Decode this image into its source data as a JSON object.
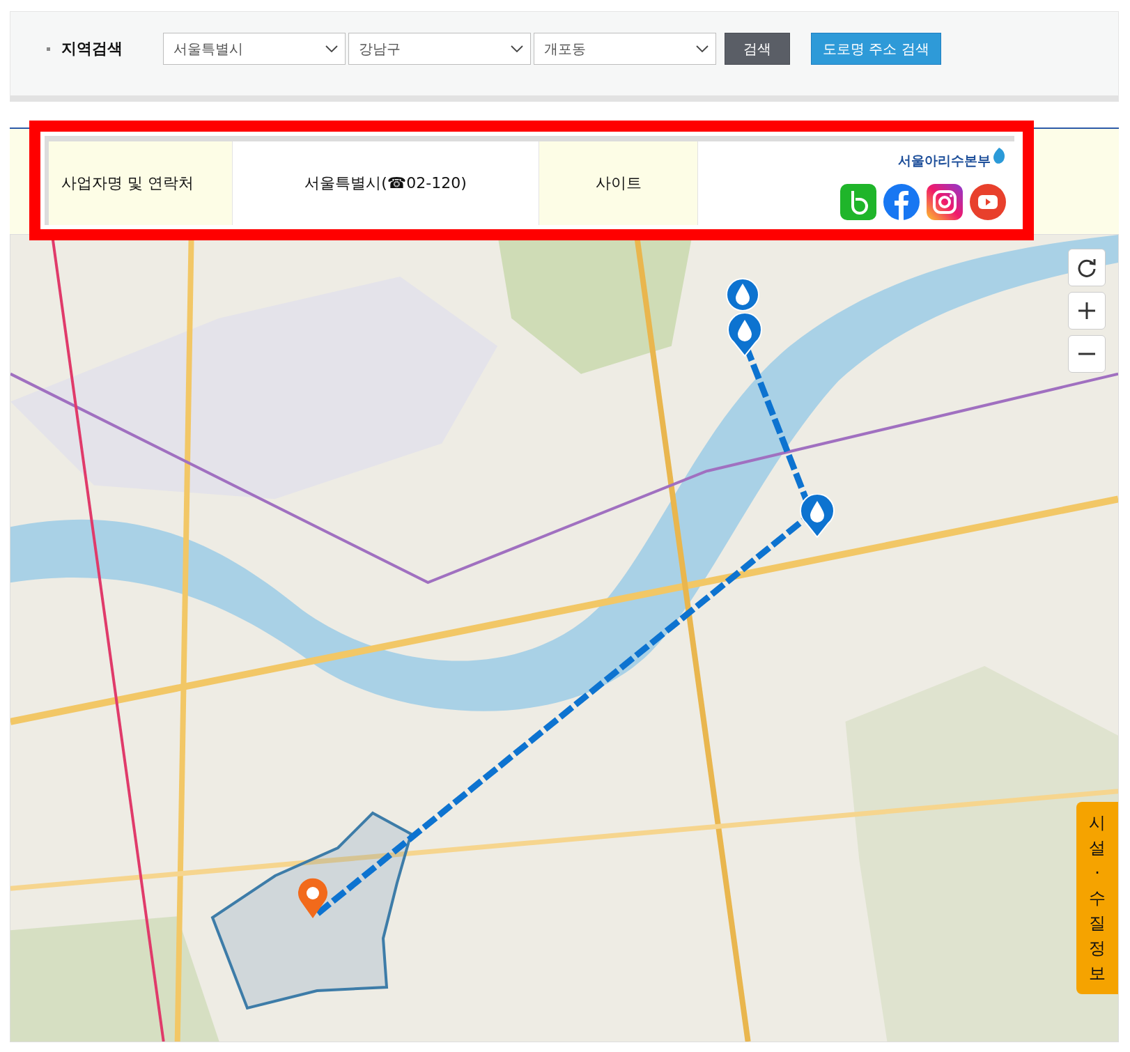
{
  "search": {
    "label": "지역검색",
    "selects": [
      {
        "value": "서울특별시"
      },
      {
        "value": "강남구"
      },
      {
        "value": "개포동"
      }
    ],
    "buttons": [
      {
        "label": "검색",
        "kind": "dark"
      },
      {
        "label": "도로명 주소 검색",
        "kind": "blue"
      }
    ]
  },
  "info": {
    "cells": [
      {
        "text": "사업자명 및 연락처",
        "kind": "header"
      },
      {
        "text": "서울특별시(☎02-120)",
        "kind": "value"
      },
      {
        "text": "사이트",
        "kind": "header"
      }
    ],
    "logo": "서울아리수본부"
  },
  "side_tab": {
    "label": "시설·수질정보"
  }
}
